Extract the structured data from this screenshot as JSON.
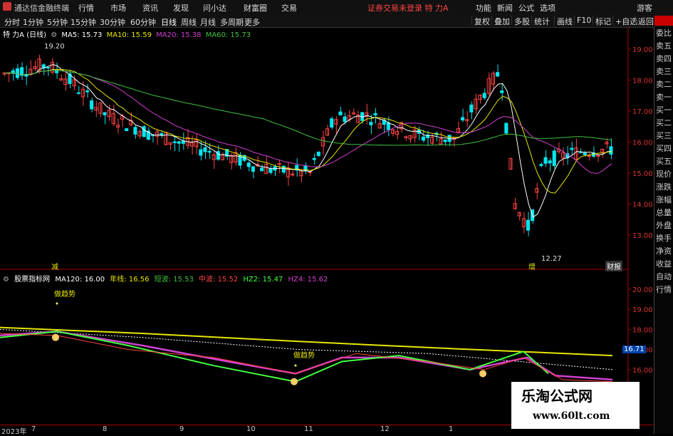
{
  "app": {
    "title": "通达信金融终端",
    "status": "证券交易未登录  特 力A"
  },
  "menu": [
    "行情",
    "市场",
    "资讯",
    "发现",
    "问小达",
    "财富圈",
    "交易"
  ],
  "right_menu": [
    "功能",
    "新闻",
    "公式",
    "选项",
    "游客"
  ],
  "periods": [
    "分时",
    "1分钟",
    "5分钟",
    "15分钟",
    "30分钟",
    "60分钟",
    "日线",
    "周线",
    "月线",
    "多周期",
    "更多"
  ],
  "active_period": "日线",
  "tools": [
    "复权",
    "叠加",
    "多股",
    "统计",
    "画线",
    "F10",
    "标记",
    "+自选",
    "返回"
  ],
  "stock_label": "特 力A (日线)",
  "ma_legend": [
    {
      "label": "MA5: 15.73",
      "color": "#ffffff"
    },
    {
      "label": "MA10: 15.59",
      "color": "#e6e600"
    },
    {
      "label": "MA20: 15.38",
      "color": "#d040d0"
    },
    {
      "label": "MA60: 15.73",
      "color": "#40c040"
    }
  ],
  "indicator_title": "股票指标网",
  "indicator_legend": [
    {
      "label": "MA120: 16.00",
      "color": "#ffffff"
    },
    {
      "label": "年线: 16.56",
      "color": "#e6e600"
    },
    {
      "label": "短波: 15.53",
      "color": "#40c040"
    },
    {
      "label": "中波: 15.52",
      "color": "#ff4444"
    },
    {
      "label": "HZ2: 15.47",
      "color": "#40ff40"
    },
    {
      "label": "HZ4: 15.62",
      "color": "#d040d0"
    }
  ],
  "price_axis": [
    "19.00",
    "18.00",
    "17.00",
    "16.00",
    "15.00",
    "14.00",
    "13.00"
  ],
  "ind_axis": [
    "20.00",
    "19.00",
    "18.00",
    "17.00",
    "16.00"
  ],
  "current_value": "16.71",
  "annotations": {
    "high": "19.20",
    "low": "12.27",
    "trend1": "做趋势",
    "trend2": "做趋势",
    "tag_left": "减",
    "tag_mid": "增",
    "tag_right": "财报"
  },
  "side_panel": [
    "委比",
    "卖五",
    "卖四",
    "卖三",
    "卖二",
    "卖一",
    "买一",
    "买二",
    "买三",
    "买四",
    "买五",
    "现价",
    "涨跌",
    "涨幅",
    "总量",
    "外盘",
    "换手",
    "净资",
    "收益",
    "自动",
    "行情"
  ],
  "dates": [
    "2023年",
    "7",
    "8",
    "9",
    "10",
    "11",
    "12",
    "1"
  ],
  "watermark": {
    "line1": "乐淘公式网",
    "line2": "www.60lt.com"
  },
  "colors": {
    "up": "#ff4444",
    "down": "#00ffff",
    "bg": "#000000",
    "grid": "#551111"
  }
}
